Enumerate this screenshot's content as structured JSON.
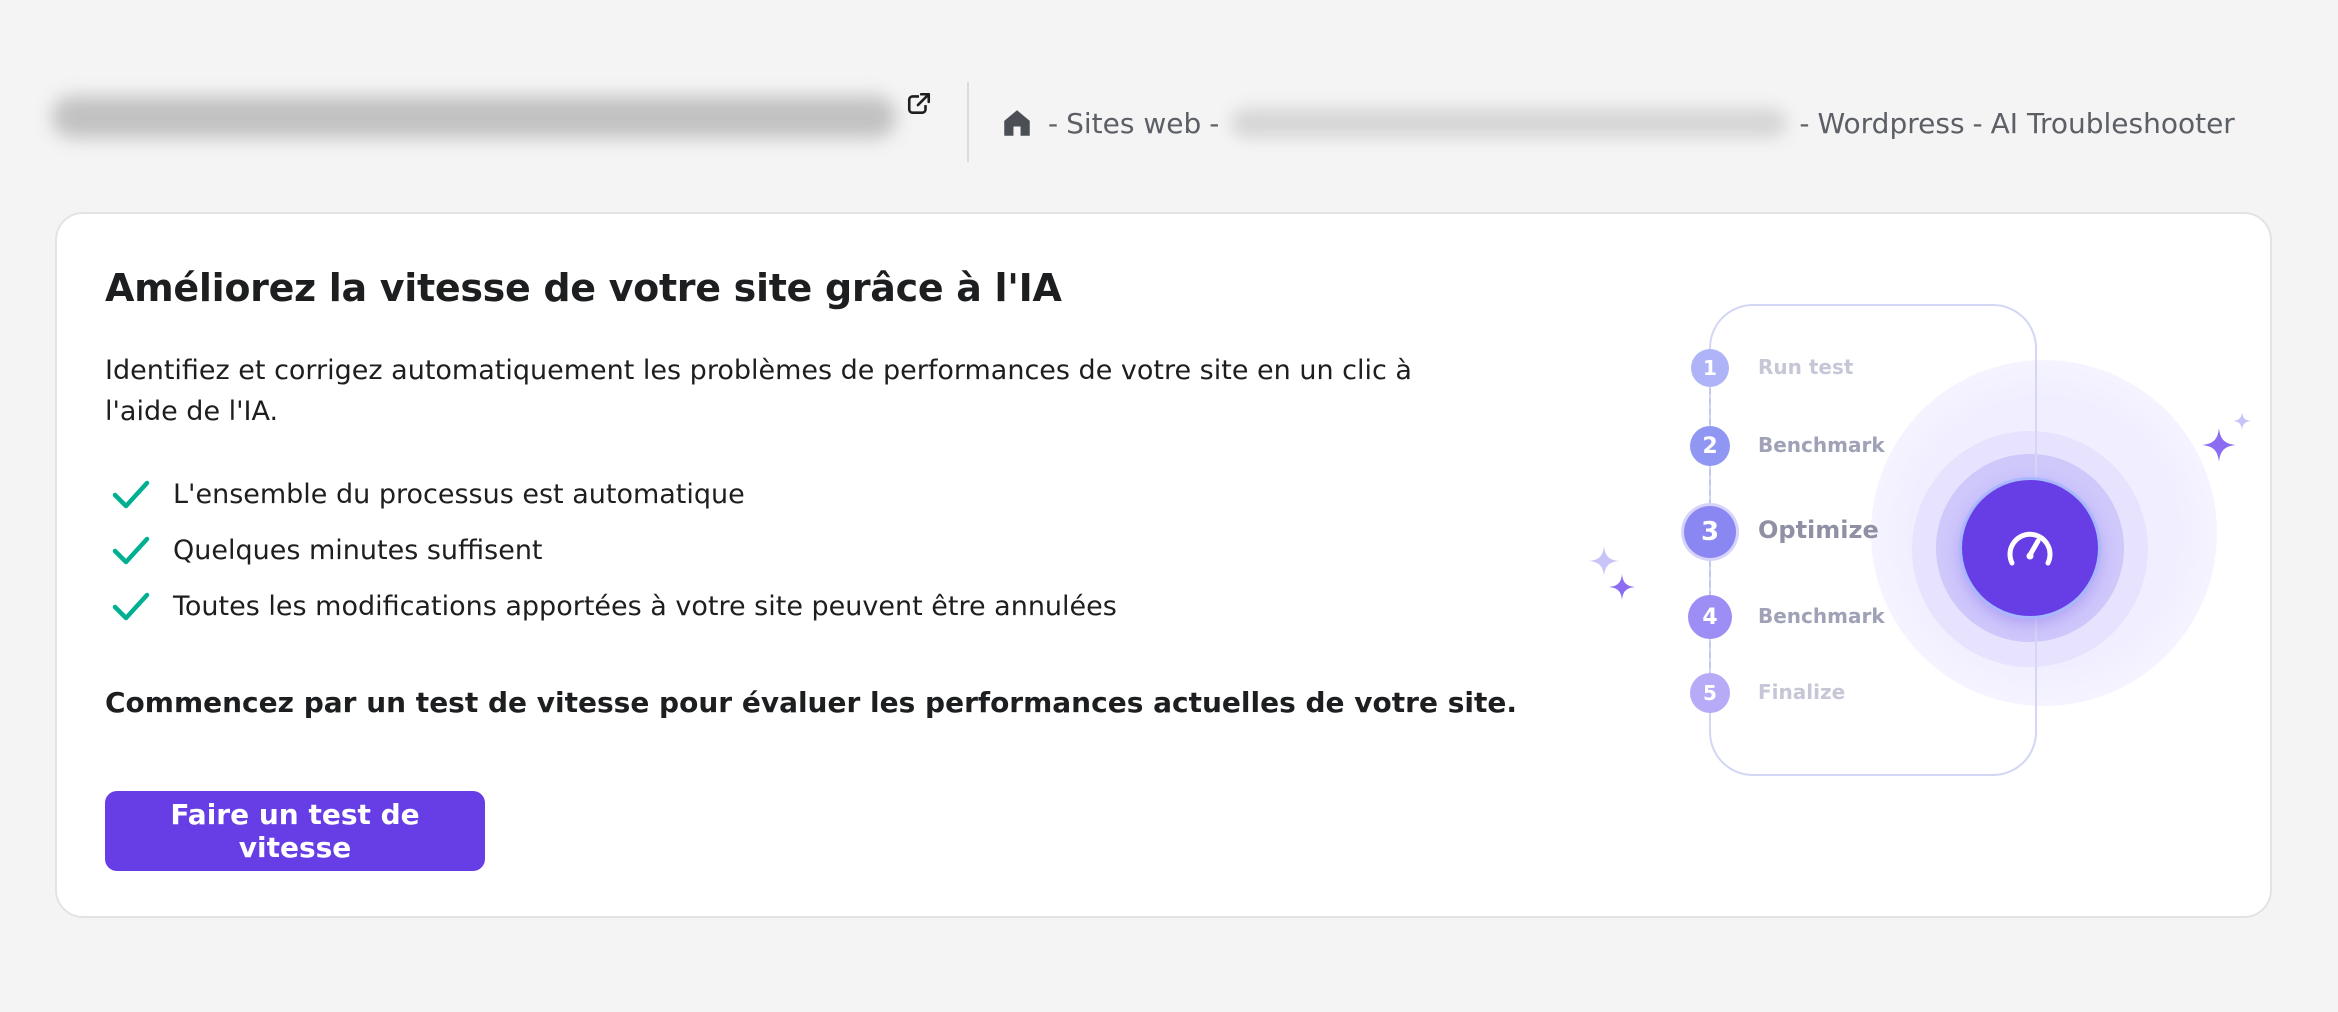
{
  "topbar": {
    "open_external_icon": "external-link-icon",
    "home_icon": "home-icon",
    "crumb_sep": "-",
    "crumb_sites": "Sites web",
    "crumb_wordpress": "Wordpress",
    "crumb_tool": "AI Troubleshooter"
  },
  "card": {
    "title": "Améliorez la vitesse de votre site grâce à l'IA",
    "description": "Identifiez et corrigez automatiquement les problèmes de performances de votre site en un clic à l'aide de l'IA.",
    "checks": [
      "L'ensemble du processus est automatique",
      "Quelques minutes suffisent",
      "Toutes les modifications apportées à votre site peuvent être annulées"
    ],
    "cta_text": "Commencez par un test de vitesse pour évaluer les performances actuelles de votre site.",
    "cta_button": "Faire un test de vitesse"
  },
  "illustration": {
    "steps": [
      {
        "num": "1",
        "label": "Run test"
      },
      {
        "num": "2",
        "label": "Benchmark"
      },
      {
        "num": "3",
        "label": "Optimize"
      },
      {
        "num": "4",
        "label": "Benchmark"
      },
      {
        "num": "5",
        "label": "Finalize"
      }
    ],
    "center_icon": "speedometer-icon"
  },
  "colors": {
    "accent": "#673de6",
    "check": "#00b090",
    "background": "#f4f4f4"
  }
}
